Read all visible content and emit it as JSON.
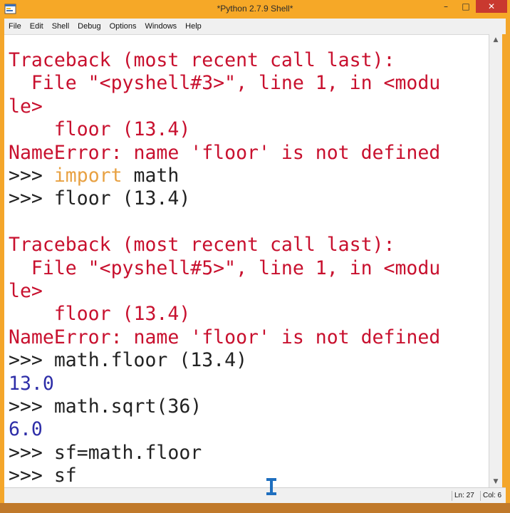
{
  "window": {
    "title": "*Python 2.7.9 Shell*",
    "controls": {
      "minimize": "–",
      "maximize": "□",
      "close": "✕"
    },
    "app_icon": "python-shell-icon"
  },
  "menu": [
    "File",
    "Edit",
    "Shell",
    "Debug",
    "Options",
    "Windows",
    "Help"
  ],
  "shell_lines": [
    {
      "kind": "error",
      "text": "Traceback (most recent call last):"
    },
    {
      "kind": "error",
      "text": "  File \"<pyshell#3>\", line 1, in <modu"
    },
    {
      "kind": "error",
      "text": "le>"
    },
    {
      "kind": "error",
      "text": "    floor (13.4)"
    },
    {
      "kind": "error",
      "text": "NameError: name 'floor' is not defined"
    },
    {
      "kind": "input",
      "prompt": ">>> ",
      "keyword": "import",
      "text": " math"
    },
    {
      "kind": "input",
      "prompt": ">>> ",
      "text": "floor (13.4)"
    },
    {
      "kind": "blank",
      "text": ""
    },
    {
      "kind": "error",
      "text": "Traceback (most recent call last):"
    },
    {
      "kind": "error",
      "text": "  File \"<pyshell#5>\", line 1, in <modu"
    },
    {
      "kind": "error",
      "text": "le>"
    },
    {
      "kind": "error",
      "text": "    floor (13.4)"
    },
    {
      "kind": "error",
      "text": "NameError: name 'floor' is not defined"
    },
    {
      "kind": "input",
      "prompt": ">>> ",
      "text": "math.floor (13.4)"
    },
    {
      "kind": "output",
      "text": "13.0"
    },
    {
      "kind": "input",
      "prompt": ">>> ",
      "text": "math.sqrt(36)"
    },
    {
      "kind": "output",
      "text": "6.0"
    },
    {
      "kind": "input",
      "prompt": ">>> ",
      "text": "sf=math.floor"
    },
    {
      "kind": "input",
      "prompt": ">>> ",
      "text": "sf"
    }
  ],
  "status": {
    "line": "Ln: 27",
    "col": "Col: 6"
  },
  "colors": {
    "title_bar": "#f6a827",
    "close_button": "#c9392f",
    "error_text": "#c8102e",
    "keyword": "#e8a142",
    "output": "#2e2ea8",
    "code": "#222222"
  }
}
